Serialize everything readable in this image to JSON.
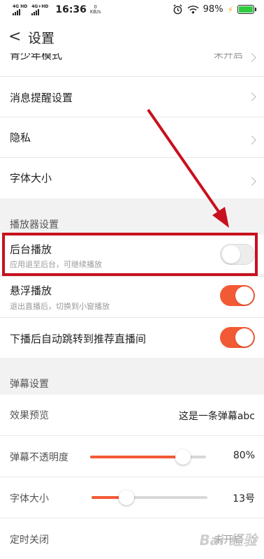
{
  "status_bar": {
    "sim1_label": "4G HD",
    "sim2_label": "4G+HD",
    "time": "16:36",
    "speed_value": "0",
    "speed_unit": "KB/s",
    "battery_percent": "98%",
    "battery_level": 0.98
  },
  "header": {
    "title": "设置"
  },
  "general": {
    "teen_mode_label": "青少年模式",
    "teen_mode_value": "未开启",
    "notify_label": "消息提醒设置",
    "privacy_label": "隐私",
    "font_size_label": "字体大小"
  },
  "player": {
    "section_title": "播放器设置",
    "background_play": {
      "label": "后台播放",
      "desc": "应用退至后台，可继续播放",
      "enabled": false
    },
    "floating_play": {
      "label": "悬浮播放",
      "desc": "退出直播后，切换到小窗播放",
      "enabled": true
    },
    "auto_jump": {
      "label": "下播后自动跳转到推荐直播间",
      "enabled": true
    }
  },
  "danmaku": {
    "section_title": "弹幕设置",
    "preview_label": "效果预览",
    "preview_text": "这是一条弹幕abc",
    "opacity_label": "弹幕不透明度",
    "opacity_value": "80%",
    "opacity_level": 0.8,
    "font_size_label": "字体大小",
    "font_size_value": "13号",
    "font_size_level": 0.3,
    "timer_label": "定时关闭",
    "timer_value": "未开启"
  },
  "colors": {
    "accent": "#f25a35",
    "highlight_box": "#c8101e"
  },
  "watermark": "Bai 经验"
}
